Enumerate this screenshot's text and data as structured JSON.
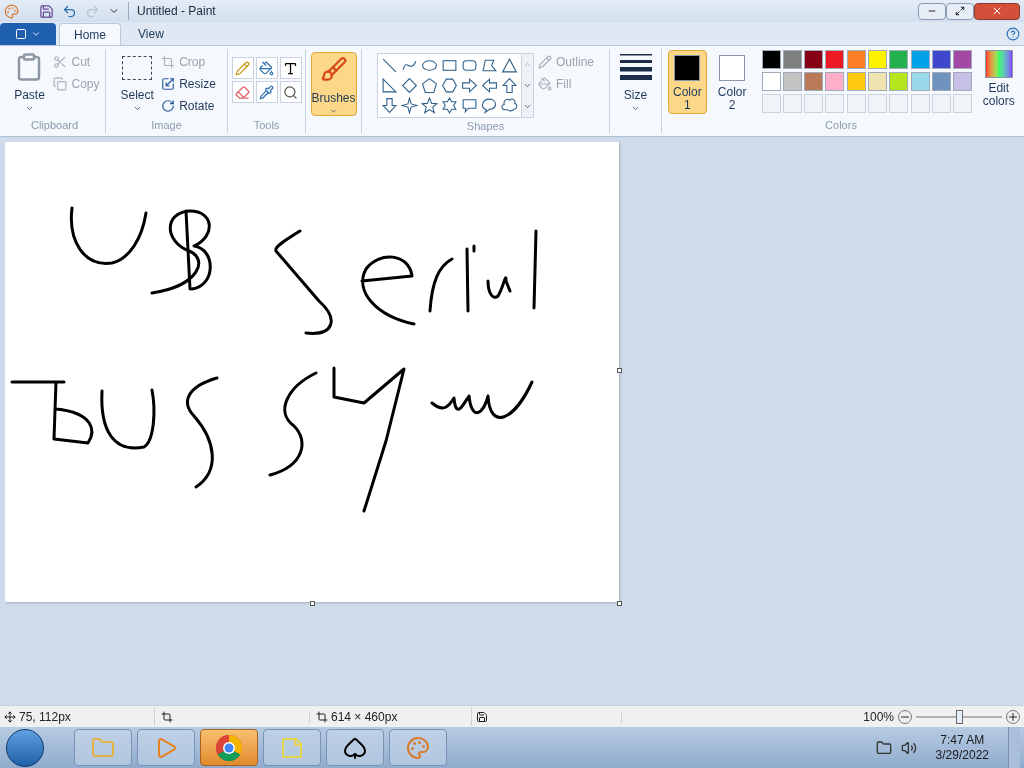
{
  "window": {
    "title": "Untitled - Paint"
  },
  "tabs": [
    {
      "label": "Home",
      "selected": true
    },
    {
      "label": "View",
      "selected": false
    }
  ],
  "clipboard": {
    "paste": "Paste",
    "cut": {
      "label": "Cut",
      "disabled": true
    },
    "copy": {
      "label": "Copy",
      "disabled": true
    },
    "label": "Clipboard"
  },
  "image": {
    "select": "Select",
    "crop": {
      "label": "Crop",
      "disabled": true
    },
    "resize": {
      "label": "Resize",
      "disabled": false
    },
    "rotate": {
      "label": "Rotate",
      "disabled": false
    },
    "label": "Image"
  },
  "tools": {
    "label": "Tools",
    "items": [
      {
        "kind": "pencil",
        "selected": false
      },
      {
        "kind": "fill",
        "selected": false
      },
      {
        "kind": "text",
        "selected": false
      },
      {
        "kind": "eraser",
        "selected": false
      },
      {
        "kind": "picker",
        "selected": false
      },
      {
        "kind": "magnifier",
        "selected": false
      }
    ]
  },
  "brushes": {
    "label": "Brushes",
    "selected": true
  },
  "shapes": {
    "label": "Shapes",
    "items": [
      {
        "kind": "line"
      },
      {
        "kind": "curve"
      },
      {
        "kind": "oval"
      },
      {
        "kind": "rectangle"
      },
      {
        "kind": "rounded-rectangle"
      },
      {
        "kind": "polygon"
      },
      {
        "kind": "triangle"
      },
      {
        "kind": "right-triangle"
      },
      {
        "kind": "diamond"
      },
      {
        "kind": "pentagon"
      },
      {
        "kind": "hexagon"
      },
      {
        "kind": "right-arrow"
      },
      {
        "kind": "left-arrow"
      },
      {
        "kind": "up-arrow"
      },
      {
        "kind": "down-arrow"
      },
      {
        "kind": "four-point-star"
      },
      {
        "kind": "five-point-star"
      },
      {
        "kind": "six-point-star"
      },
      {
        "kind": "rect-callout"
      },
      {
        "kind": "oval-callout"
      },
      {
        "kind": "cloud-callout"
      }
    ],
    "outline": {
      "label": "Outline",
      "disabled": true
    },
    "fill": {
      "label": "Fill",
      "disabled": true
    }
  },
  "size": {
    "label": "Size"
  },
  "colors": {
    "label": "Colors",
    "color1": {
      "label": "Color",
      "number": "1",
      "selected": true,
      "color": "#000000"
    },
    "color2": {
      "label": "Color",
      "number": "2",
      "selected": false,
      "color": "#ffffff"
    },
    "palette": [
      {
        "color": "#000000"
      },
      {
        "color": "#7f7f7f"
      },
      {
        "color": "#880015"
      },
      {
        "color": "#ed1c24"
      },
      {
        "color": "#ff7f27"
      },
      {
        "color": "#fff200"
      },
      {
        "color": "#22b14c"
      },
      {
        "color": "#00a2e8"
      },
      {
        "color": "#3f48cc"
      },
      {
        "color": "#a349a4"
      },
      {
        "color": "#ffffff"
      },
      {
        "color": "#c3c3c3"
      },
      {
        "color": "#b97a57"
      },
      {
        "color": "#ffaec9"
      },
      {
        "color": "#ffc90e"
      },
      {
        "color": "#efe4b0"
      },
      {
        "color": "#b5e61d"
      },
      {
        "color": "#99d9ea"
      },
      {
        "color": "#7092be"
      },
      {
        "color": "#c8bfe7"
      }
    ],
    "edit": "Edit colors"
  },
  "status_bar": {
    "position": "75, 112px",
    "canvas_size": "614 × 460px",
    "zoom": "100%",
    "zoom_level": {
      "level": 0.5
    }
  },
  "taskbar": {
    "apps": [
      {
        "kind": "explorer",
        "selected": false
      },
      {
        "kind": "media",
        "selected": false
      },
      {
        "kind": "browser",
        "selected": true
      },
      {
        "kind": "notes",
        "selected": false
      },
      {
        "kind": "cards",
        "selected": false
      },
      {
        "kind": "paint",
        "selected": false
      }
    ],
    "time": "7:47 AM",
    "date": "3/29/2022"
  }
}
